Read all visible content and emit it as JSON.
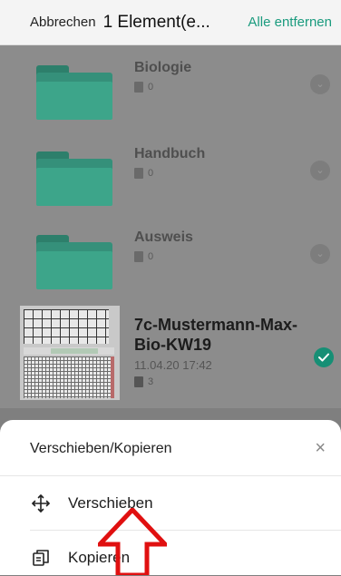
{
  "header": {
    "cancel": "Abbrechen",
    "title": "1 Element(e...",
    "clear_all": "Alle entfernen"
  },
  "folders": [
    {
      "name": "Biologie",
      "count": "0"
    },
    {
      "name": "Handbuch",
      "count": "0"
    },
    {
      "name": "Ausweis",
      "count": "0"
    }
  ],
  "document": {
    "name": "7c-Mustermann-Max-Bio-KW19",
    "date": "11.04.20 17:42",
    "pages": "3",
    "selected": true
  },
  "sheet": {
    "title": "Verschieben/Kopieren",
    "close": "×",
    "options": [
      {
        "label": "Verschieben",
        "icon": "move-arrows-icon"
      },
      {
        "label": "Kopieren",
        "icon": "copy-icon"
      }
    ]
  },
  "colors": {
    "accent": "#1a9b7e",
    "arrow": "#e01010"
  }
}
